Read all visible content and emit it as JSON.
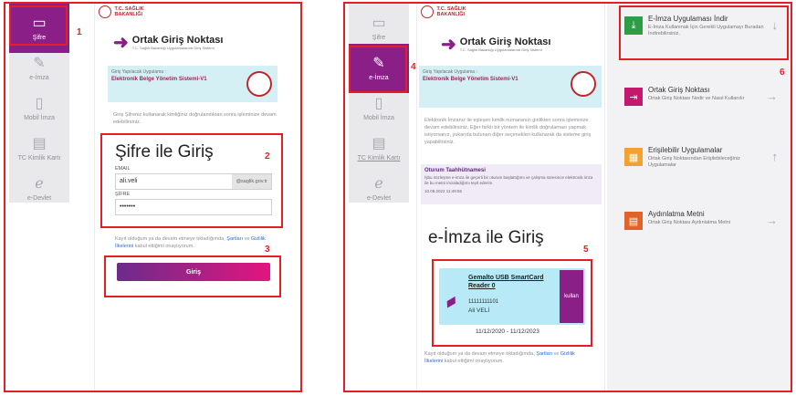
{
  "left": {
    "sidebar": [
      {
        "label": "Şifre",
        "icon": "password-icon",
        "active": true
      },
      {
        "label": "e-İmza",
        "icon": "usb-pen-icon",
        "active": false
      },
      {
        "label": "Mobil İmza",
        "icon": "mobile-icon",
        "active": false
      },
      {
        "label": "TC Kimlik Kartı",
        "icon": "id-card-icon",
        "active": false
      },
      {
        "label": "e-Devlet",
        "icon": "e-devlet-icon",
        "active": false
      }
    ],
    "ministry": [
      "T.C. SAĞLIK",
      "BAKANLIĞI"
    ],
    "brand_name": "Ortak Giriş Noktası",
    "brand_tag": "T.C. Sağlık Bakanlığı Uygulamalarına Giriş Sistemi",
    "app_label": "Giriş Yapılacak Uygulama :",
    "app_value": "Elektronik Belge Yönetim Sistemi-V1",
    "info_text": "Giriş Şifreniz kullanarak kimliğiniz doğrulandıktan sonra işleminize devam edebilirsiniz.",
    "title": "Şifre ile Giriş",
    "email_label": "EMAIL",
    "email_value": "ali.veli",
    "email_suffix": "@saglik.gov.tr",
    "password_label": "ŞİFRE",
    "password_value": "•••••••",
    "terms_pre": "Kayıt olduğum ya da devam etmeye tıkladığımda,",
    "terms_link1": "Şartları",
    "terms_mid": "ve",
    "terms_link2": "Gizlilik İlkelerini",
    "terms_post": "kabul ettiğimi onaylıyorum.",
    "login_button": "Giriş"
  },
  "right": {
    "sidebar": [
      {
        "label": "Şifre",
        "icon": "password-icon",
        "active": false
      },
      {
        "label": "e-İmza",
        "icon": "usb-pen-icon",
        "active": true
      },
      {
        "label": "Mobil İmza",
        "icon": "mobile-icon",
        "active": false
      },
      {
        "label": "TC Kimlik Kartı",
        "icon": "id-card-icon",
        "active": false
      },
      {
        "label": "e-Devlet",
        "icon": "e-devlet-icon",
        "active": false
      }
    ],
    "ministry": [
      "T.C. SAĞLIK",
      "BAKANLIĞI"
    ],
    "brand_name": "Ortak Giriş Noktası",
    "brand_tag": "T.C. Sağlık Bakanlığı Uygulamalarına Giriş Sistemi",
    "app_label": "Giriş Yapılacak Uygulama :",
    "app_value": "Elektronik Belge Yönetim Sistemi-V1",
    "info_text": "Elektronik İmzanız ile eşleşen kimlik numaranızı girilikten sonra işleminize devam edebilirsiniz. Eğer farklı bir yöntem ile kimlik doğrulaması yapmak istiyorsanız, yukarıda bulunan diğer seçenekleri kullanarak da sisteme giriş yapabilirsiniz.",
    "pledge_title": "Oturum Taahhütnamesi",
    "pledge_body": "İşbu sözleşme e-imza ile geçerli bir oturum başlattığımı ve çalışma süresince elektronik imza ile bu metni imzaladığımı teyit ederim.",
    "pledge_date": "10.08.2022 11:49:55",
    "title": "e-İmza ile Giriş",
    "card_name": "Gemalto USB SmartCard Reader 0",
    "card_number": "11111111101",
    "card_user": "Ali VELİ",
    "card_dates": "11/12/2020 - 11/12/2023",
    "use_button": "kullan",
    "terms_pre": "Kayıt olduğum ya da devam etmeye tıkladığımda,",
    "terms_link1": "Şartları",
    "terms_mid": "ve",
    "terms_link2": "Gizlilik İlkelerini",
    "terms_post": "kabul ettiğimi onaylıyorum.",
    "menu": [
      {
        "title": "E-İmza Uygulaması İndir",
        "sub": "E-İmza Kullanmak İçin Gerekli Uygulamayı Buradan İndirebilirsiniz.",
        "icon": "download-icon",
        "color": "#2e9d45",
        "arrow": "↓"
      },
      {
        "title": "Ortak Giriş Noktası",
        "sub": "Ortak Giriş Noktası Nedir ve Nasıl Kullanılır",
        "icon": "login-icon",
        "color": "#c3186d",
        "arrow": "→"
      },
      {
        "title": "Erişilebilir Uygulamalar",
        "sub": "Ortak Giriş Noktasından Erişilebileceğiniz Uygulamalar",
        "icon": "apps-grid-icon",
        "color": "#f2a233",
        "arrow": "↑"
      },
      {
        "title": "Aydınlatma Metni",
        "sub": "Ortak Giriş Noktası Aydınlatma Metni",
        "icon": "document-icon",
        "color": "#e0632a",
        "arrow": "→"
      }
    ]
  },
  "annotations": [
    "1",
    "2",
    "3",
    "4",
    "5",
    "6"
  ]
}
